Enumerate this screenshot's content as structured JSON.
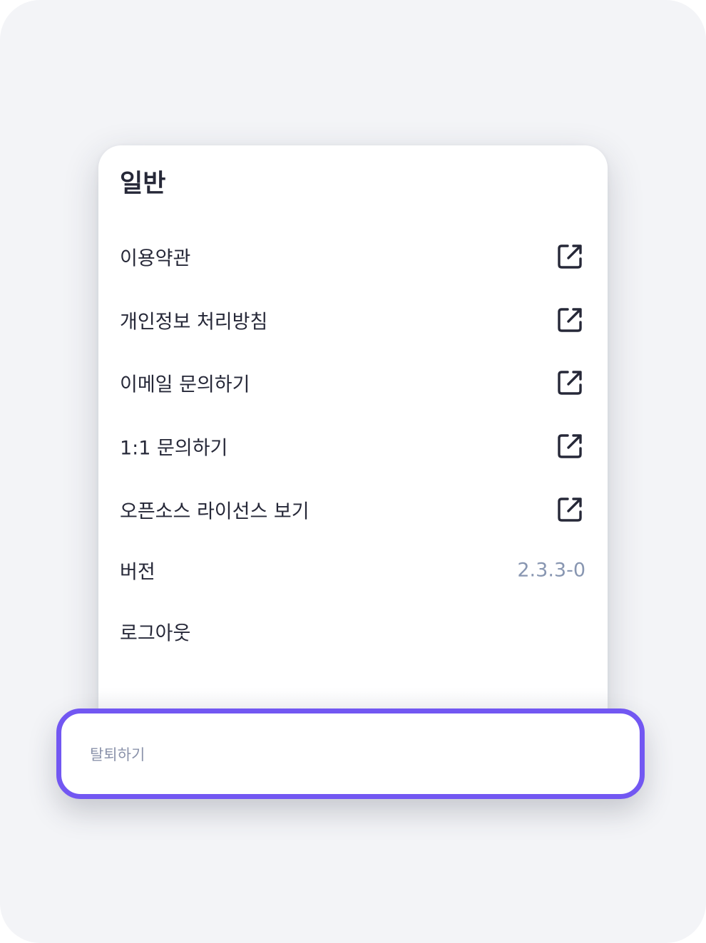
{
  "section": {
    "title": "일반"
  },
  "menu": {
    "terms": {
      "label": "이용약관",
      "icon": "external-link-icon"
    },
    "privacy": {
      "label": "개인정보 처리방침",
      "icon": "external-link-icon"
    },
    "email_inquiry": {
      "label": "이메일 문의하기",
      "icon": "external-link-icon"
    },
    "one_on_one": {
      "label": "1:1 문의하기",
      "icon": "external-link-icon"
    },
    "licenses": {
      "label": "오픈소스 라이선스 보기",
      "icon": "external-link-icon"
    },
    "version": {
      "label": "버전",
      "value": "2.3.3-0"
    },
    "logout": {
      "label": "로그아웃"
    }
  },
  "withdraw": {
    "label": "탈퇴하기",
    "highlight_color": "#7257f2"
  },
  "colors": {
    "text_primary": "#262838",
    "text_secondary": "#8896b1",
    "background": "#f3f4f7",
    "accent": "#7257f2"
  }
}
